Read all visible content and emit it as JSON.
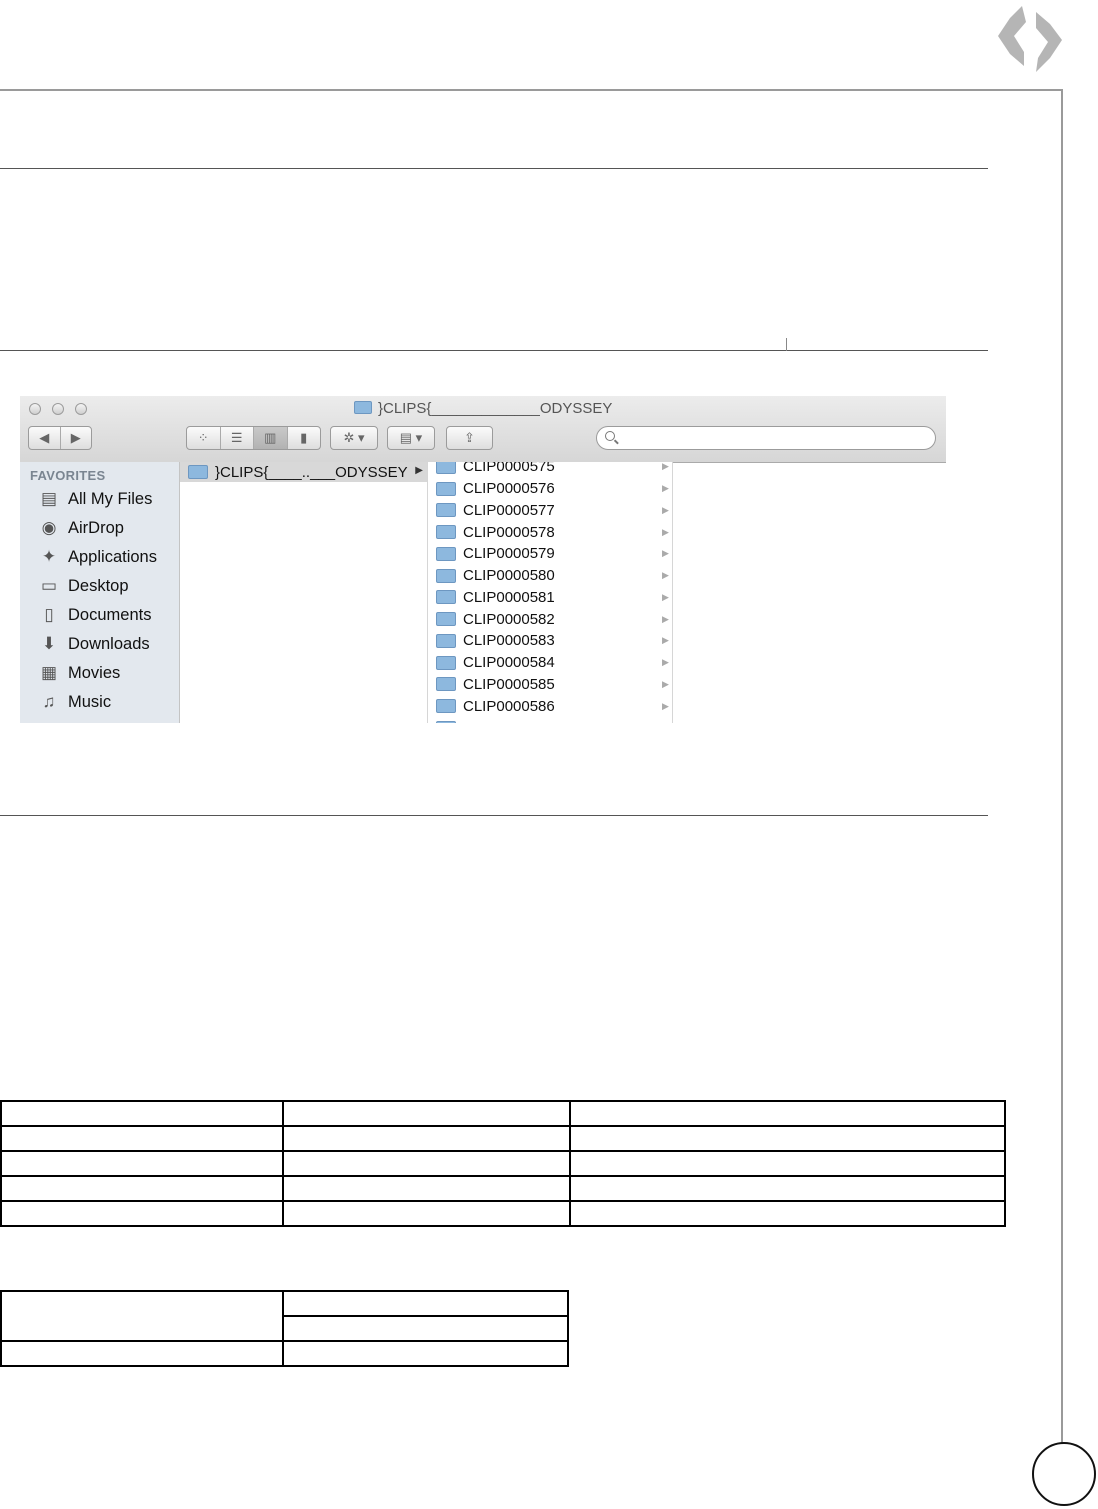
{
  "finder": {
    "window_title": "}CLIPS{_____________ODYSSEY",
    "favorites_heading": "FAVORITES",
    "sidebar_items": [
      {
        "label": "All My Files",
        "icon": "all-files-icon",
        "glyph": "▤"
      },
      {
        "label": "AirDrop",
        "icon": "airdrop-icon",
        "glyph": "◉"
      },
      {
        "label": "Applications",
        "icon": "applications-icon",
        "glyph": "✦"
      },
      {
        "label": "Desktop",
        "icon": "desktop-icon",
        "glyph": "▭"
      },
      {
        "label": "Documents",
        "icon": "documents-icon",
        "glyph": "▯"
      },
      {
        "label": "Downloads",
        "icon": "downloads-icon",
        "glyph": "⬇"
      },
      {
        "label": "Movies",
        "icon": "movies-icon",
        "glyph": "▦"
      },
      {
        "label": "Music",
        "icon": "music-icon",
        "glyph": "♫"
      }
    ],
    "column1_selected": "}CLIPS{____..___ODYSSEY",
    "column2_items": [
      "CLIP0000575",
      "CLIP0000576",
      "CLIP0000577",
      "CLIP0000578",
      "CLIP0000579",
      "CLIP0000580",
      "CLIP0000581",
      "CLIP0000582",
      "CLIP0000583",
      "CLIP0000584",
      "CLIP0000585",
      "CLIP0000586"
    ]
  },
  "colors": {
    "frame": "#9a9a9a",
    "sidebar_bg": "#e3e8ee",
    "folder_blue": "#8db8de",
    "logo_gray": "#b5b5b5"
  }
}
